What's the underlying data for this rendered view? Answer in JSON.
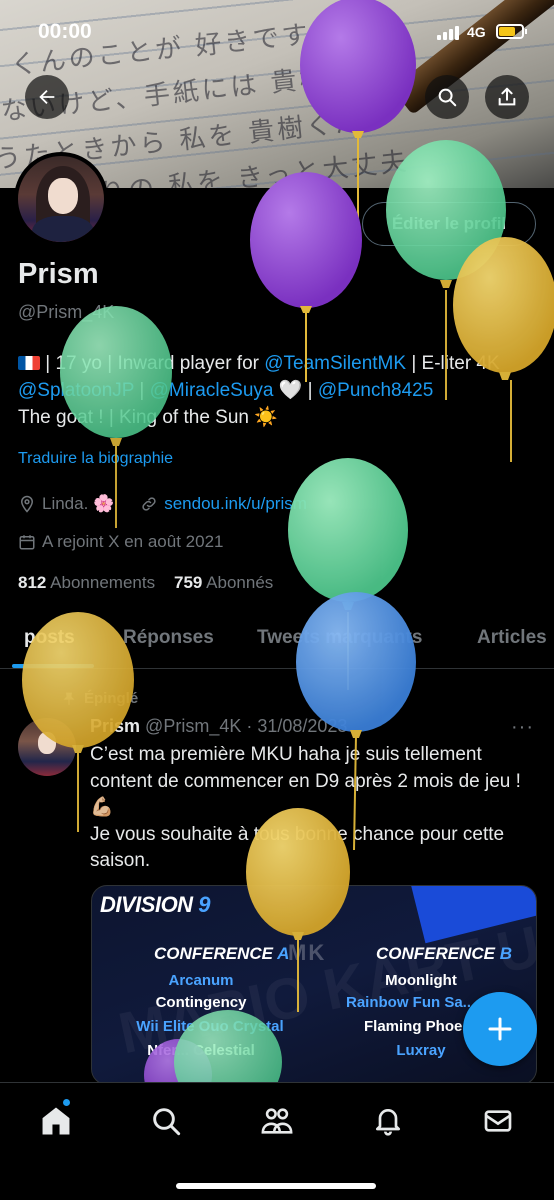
{
  "status_bar": {
    "time": "00:00",
    "network": "4G"
  },
  "profile": {
    "edit_label": "Éditer le profil",
    "name": "Prism",
    "handle": "@Prism_4K",
    "bio": {
      "seg1": " | 17 yo | Inward player for ",
      "team": "@TeamSilentMK",
      "seg2": " | E-liter 4K ",
      "m1": "@SplatoonJP",
      "seg3": " | ",
      "m2": "@MiracleSuya",
      "seg4": " 🤍 | ",
      "m3": "@Punch8425",
      "line3": "The goat ! | King of the Sun ☀️"
    },
    "translate": "Traduire la biographie",
    "location": "Linda. 🌸",
    "link": "sendou.ink/u/prism",
    "joined": "A rejoint X en août 2021",
    "following_count": "812",
    "following_label": "Abonnements",
    "followers_count": "759",
    "followers_label": "Abonnés"
  },
  "tabs": [
    "posts",
    "Réponses",
    "Tweets marquants",
    "Articles"
  ],
  "post": {
    "pinned_label": "Épinglé",
    "author": "Prism",
    "handle": "@Prism_4K",
    "date": "31/08/2023",
    "more": "···",
    "text1": "C’est ma première MKU haha je suis tellement content de commencer en D9 après 2 mois de jeu ! 💪🏼",
    "text2": "Je vous souhaite à tous bonne chance pour cette saison.",
    "media": {
      "division_prefix": "DIVISION",
      "division_num": "9",
      "mk": "MK",
      "watermark": "MARIO KART UNIVERSAL",
      "conf_a_prefix": "CONFERENCE",
      "conf_a_letter": "A",
      "conf_b_prefix": "CONFERENCE",
      "conf_b_letter": "B",
      "teams_a": [
        "Arcanum",
        "Contingency",
        "Wii Elite Ouo Crystal",
        "Nfer... Celestial"
      ],
      "teams_b": [
        "Moonlight",
        "Rainbow Fun Sa...",
        "Flaming Phoe...",
        "Luxray"
      ]
    }
  },
  "colors": {
    "accent": "#1d9bf0",
    "balloon_purple": "#8a3fd1",
    "balloon_green": "#5fd39a",
    "balloon_yellow": "#e2b93a",
    "balloon_blue": "#4a8fe0"
  }
}
